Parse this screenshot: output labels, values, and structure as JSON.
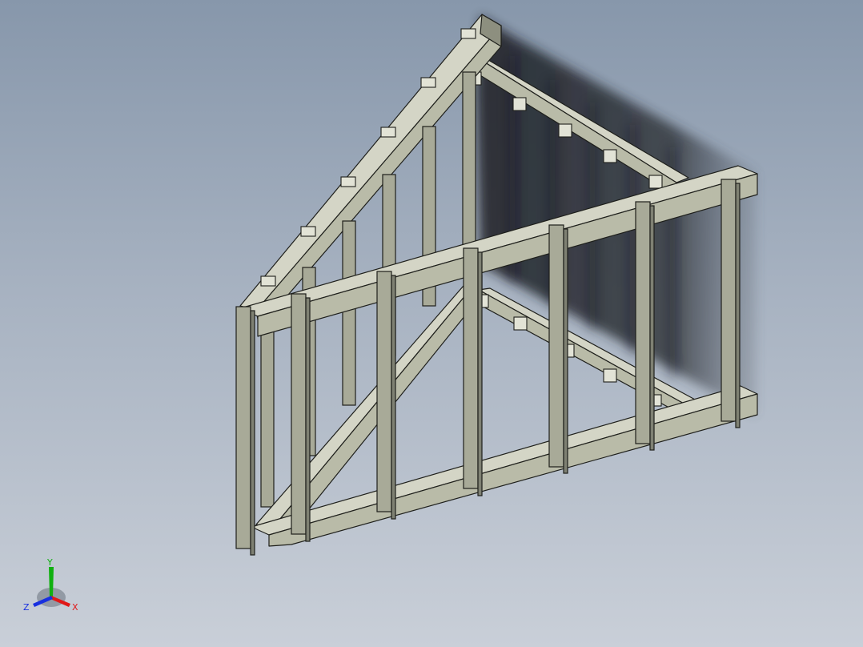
{
  "viewport": {
    "background_top": "#8797ab",
    "background_bottom": "#c9cfd8",
    "model_color": "#b9bba8",
    "edge_color": "#1e1f1b"
  },
  "triad": {
    "x_label": "X",
    "y_label": "Y",
    "z_label": "Z",
    "x_color": "#e01818",
    "y_color": "#10b010",
    "z_color": "#1830e0"
  }
}
